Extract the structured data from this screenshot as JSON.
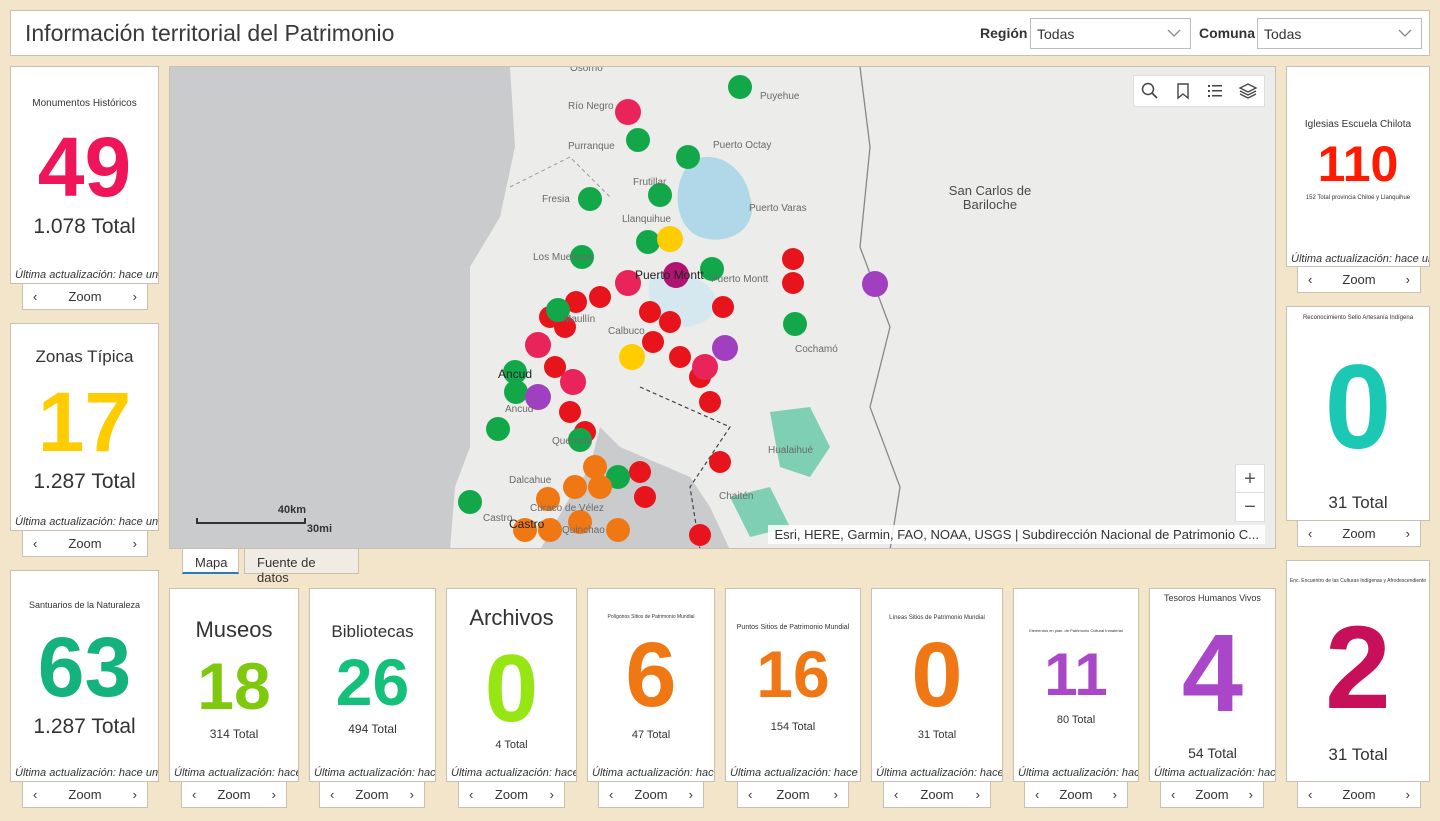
{
  "header": {
    "title": "Información territorial del Patrimonio",
    "region_label": "Región",
    "region_value": "Todas",
    "comuna_label": "Comuna",
    "comuna_value": "Todas"
  },
  "zoom_label": "Zoom",
  "update_text": "Última actualización: hace unos",
  "cards": {
    "monumentos": {
      "title": "Monumentos Históricos",
      "value": "49",
      "total": "1.078 Total",
      "color": "#f0145a"
    },
    "zonas": {
      "title": "Zonas Típica",
      "value": "17",
      "total": "1.287 Total",
      "color": "#ffcc00"
    },
    "santuarios": {
      "title": "Santuarios de la Naturaleza",
      "value": "63",
      "total": "1.287 Total",
      "color": "#14b27d"
    },
    "iglesias": {
      "title": "Iglesias Escuela Chilota",
      "value": "110",
      "subtitle": "152 Total provincia Chiloé y Llanquihue",
      "color": "#ff1a00"
    },
    "artesania": {
      "title": "Reconocimiento Sello Artesanía Indígena",
      "value": "0",
      "total": "31 Total",
      "color": "#1ac8b4"
    },
    "encuentro": {
      "title": "Enc. Encuentro de las Culturas Indígenas y Afrodescendiente",
      "value": "2",
      "total": "31 Total",
      "color": "#c8105a"
    },
    "museos": {
      "title": "Museos",
      "value": "18",
      "total": "314 Total",
      "color": "#7ec80e"
    },
    "bibliotecas": {
      "title": "Bibliotecas",
      "value": "26",
      "total": "494 Total",
      "color": "#14c07a"
    },
    "archivos": {
      "title": "Archivos",
      "value": "0",
      "total": "4 Total",
      "color": "#96e614"
    },
    "poligonos": {
      "title": "Polígonos Sitios de Patrimonio Mundial",
      "value": "6",
      "total": "47 Total",
      "color": "#f07814"
    },
    "puntos": {
      "title": "Puntos Sitios de Patrimonio Mundial",
      "value": "16",
      "total": "154 Total",
      "color": "#f07814"
    },
    "lineas": {
      "title": "Líneas Sitios de Patrimonio Mundial",
      "value": "0",
      "total": "31 Total",
      "color": "#f07814"
    },
    "elementos": {
      "title": "Elementos en plan. de Patrimonio Cultural Inmaterial",
      "value": "11",
      "total": "80 Total",
      "color": "#aa46c8"
    },
    "tesoros": {
      "title": "Tesoros Humanos Vivos",
      "value": "4",
      "total": "54 Total",
      "color": "#aa46c8"
    }
  },
  "map": {
    "attribution": "Esri, HERE, Garmin, FAO, NOAA, USGS | Subdirección Nacional de Patrimonio C...",
    "scale_km": "40km",
    "scale_mi": "30mi",
    "zoom_in": "+",
    "zoom_out": "−",
    "places": {
      "osorno": "Osorno",
      "rionegro": "Río Negro",
      "purranque": "Purranque",
      "puyehue": "Puyehue",
      "puertooctay": "Puerto Octay",
      "frutillar": "Frutillar",
      "fresia": "Fresia",
      "puertovaras": "Puerto Varas",
      "llanquihue": "Llanquihue",
      "losmuermos": "Los Muermos",
      "puertomontt": "Puerto Montt",
      "puertomontt2": "Puerto Montt",
      "maullin": "Maullín",
      "calbuco": "Calbuco",
      "cochamo": "Cochamó",
      "ancud": "Ancud",
      "ancud2": "Ancud",
      "quemchi": "Quemchi",
      "dalcahue": "Dalcahue",
      "castro": "Castro",
      "castro2": "Castro",
      "curaco": "Curaco de Vélez",
      "quinchao": "Quinchao",
      "hualaihue": "Hualaihué",
      "chaiten": "Chaitén",
      "bariloche": "San Carlos de Bariloche"
    }
  },
  "tabs": {
    "mapa": "Mapa",
    "fuente": "Fuente de datos"
  }
}
